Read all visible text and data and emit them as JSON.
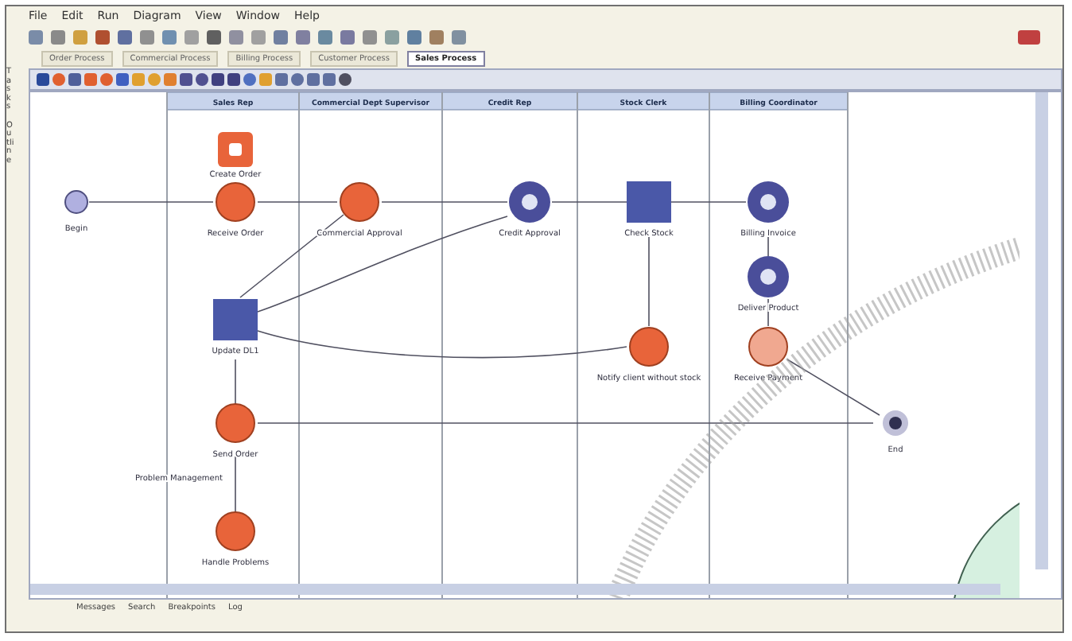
{
  "menu": [
    "File",
    "Edit",
    "Run",
    "Diagram",
    "View",
    "Window",
    "Help"
  ],
  "editor_tabs": [
    {
      "label": "Order Process",
      "selected": false
    },
    {
      "label": "Commercial Process",
      "selected": false
    },
    {
      "label": "Billing Process",
      "selected": false
    },
    {
      "label": "Customer Process",
      "selected": false
    },
    {
      "label": "Sales Process",
      "selected": true
    }
  ],
  "side_tabs": [
    "Tasks",
    "Outline"
  ],
  "lanes": [
    "Sales Rep",
    "Commercial Dept Supervisor",
    "Credit Rep",
    "Stock Clerk",
    "Billing Coordinator"
  ],
  "nodes": [
    {
      "kind": "start",
      "label": "Begin"
    },
    {
      "kind": "task",
      "label": "Create Order"
    },
    {
      "kind": "activity",
      "label": "Receive Order"
    },
    {
      "kind": "activity",
      "label": "Commercial Approval"
    },
    {
      "kind": "subflow",
      "label": "Credit Approval"
    },
    {
      "kind": "gateway",
      "label": "Check Stock"
    },
    {
      "kind": "subflow",
      "label": "Billing Invoice"
    },
    {
      "kind": "subflow",
      "label": "Deliver Product"
    },
    {
      "kind": "activity",
      "label": "Notify client without stock"
    },
    {
      "kind": "pending",
      "label": "Receive Payment"
    },
    {
      "kind": "gateway",
      "label": "Update DL1"
    },
    {
      "kind": "activity",
      "label": "Send Order"
    },
    {
      "kind": "activity",
      "label": "Handle Problems"
    },
    {
      "kind": "end",
      "label": "End"
    }
  ],
  "exception_label": "Problem Management",
  "status_items": [
    "Messages",
    "Search",
    "Breakpoints",
    "Log"
  ]
}
